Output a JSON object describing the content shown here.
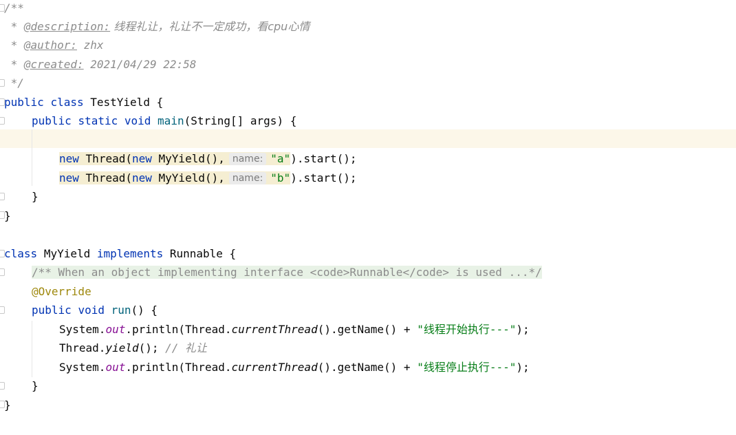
{
  "doc": {
    "open": "/**",
    "star": " * ",
    "desc_tag": "@description:",
    "desc_val": " 线程礼让，礼让不一定成功，看cpu心情",
    "author_tag": "@author:",
    "author_val": " zhx",
    "created_tag": "@created:",
    "created_val": " 2021/04/29 22:58",
    "close": " */"
  },
  "code": {
    "kw_public": "public",
    "kw_class": "class",
    "kw_static": "static",
    "kw_void": "void",
    "kw_new": "new",
    "kw_implements": "implements",
    "class1": "TestYield",
    "main": "main",
    "main_params": "(String[] args) {",
    "brace_open": " {",
    "brace_close": "}",
    "thread_ctor": "Thread(",
    "myyield_call": "MyYield(),",
    "hint_name": "name:",
    "str_a": "\"a\"",
    "str_b": "\"b\"",
    "start_call": ").start();",
    "class2": "MyYield",
    "runnable": "Runnable",
    "folded_doc": "/** When an object implementing interface <code>Runnable</code> is used ...*/",
    "override": "@Override",
    "run": "run",
    "run_params": "() {",
    "system": "System.",
    "out": "out",
    "println": ".println(Thread.",
    "current_thread": "currentThread",
    "get_name": "().getName() + ",
    "str_start": "\"线程开始执行---\"",
    "str_stop": "\"线程停止执行---\"",
    "call_end": ");",
    "thread_dot": "Thread.",
    "yield": "yield",
    "yield_end": "();",
    "line_comment": "// 礼让"
  }
}
